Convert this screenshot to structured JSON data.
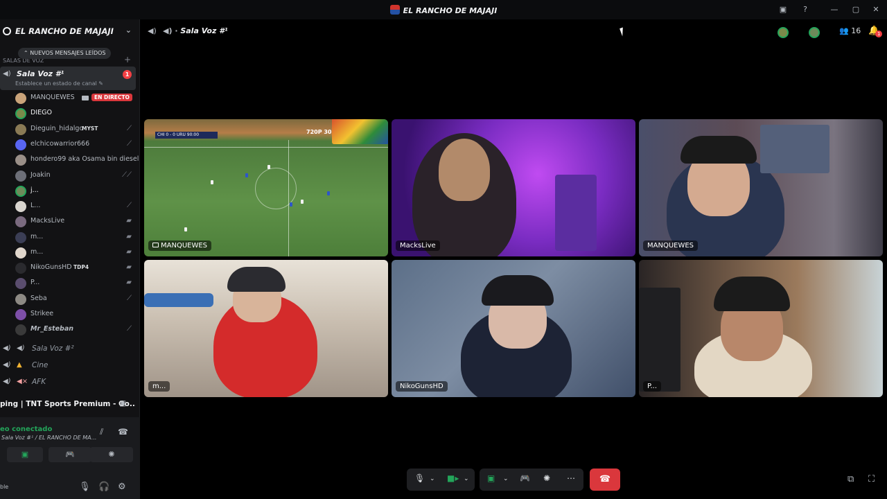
{
  "window": {
    "title": "EL RANCHO DE MAJAJI",
    "min": "—",
    "max": "▢",
    "close": "✕"
  },
  "server": {
    "name": "EL RANCHO DE MAJAJI"
  },
  "sidebar": {
    "unread_pill": "NUEVOS MENSAJES LEÍDOS",
    "category": "SALAS DE VOZ",
    "active_channel": {
      "name": "Sala Voz #¹",
      "status": "Establece un estado de canal",
      "badge": "1"
    },
    "users": [
      {
        "name": "MANQUEWES",
        "live": "EN DIRECTO"
      },
      {
        "name": "DIEGO"
      },
      {
        "name": "Dieguin_hidalgo",
        "tag": "MYST"
      },
      {
        "name": "elchicowarrior666"
      },
      {
        "name": "hondero99 aka Osama bin diesel"
      },
      {
        "name": "Joakin"
      },
      {
        "name": "j..."
      },
      {
        "name": "L..."
      },
      {
        "name": "MacksLive"
      },
      {
        "name": "m..."
      },
      {
        "name": "m..."
      },
      {
        "name": "NikoGunsHD",
        "tag": "TDP4"
      },
      {
        "name": "P..."
      },
      {
        "name": "Seba"
      },
      {
        "name": "Strikee"
      },
      {
        "name": "Mr_Esteban"
      }
    ],
    "channels": [
      {
        "name": "Sala Voz #²"
      },
      {
        "name": "Cine"
      },
      {
        "name": "AFK"
      }
    ],
    "stream_row": "ping | TNT Sports Premium - Go...",
    "voice": {
      "connected": "eo conectado",
      "channel": "Sala Voz #¹ / EL RANCHO DE MA..."
    },
    "user_bar_text": "ble"
  },
  "header": {
    "channel": "Sala Voz #¹",
    "member_count": "16",
    "notif_count": "1"
  },
  "tiles": [
    {
      "label": "MANQUEWES",
      "score_text": "CHI 0 - 0 URU  90:00",
      "quality": "720P 30F",
      "kind": "stream"
    },
    {
      "label": "MacksLive",
      "kind": "cam"
    },
    {
      "label": "MANQUEWES",
      "kind": "cam"
    },
    {
      "label": "m...",
      "kind": "cam"
    },
    {
      "label": "NikoGunsHD",
      "kind": "cam"
    },
    {
      "label": "P...",
      "kind": "cam"
    }
  ],
  "colors": {
    "accent_green": "#23a55a",
    "danger": "#da373c",
    "sidebar_bg": "#121214"
  },
  "icons": {
    "mic": "🎙",
    "headphones": "🎧",
    "settings": "⚙",
    "camera": "📹",
    "screen": "🖥",
    "activity": "🎮",
    "soundboard": "✺",
    "more": "⋯",
    "hangup": "☎",
    "popout": "⧉",
    "fullscreen": "⛶",
    "members": "👥",
    "bell": "🔔"
  }
}
